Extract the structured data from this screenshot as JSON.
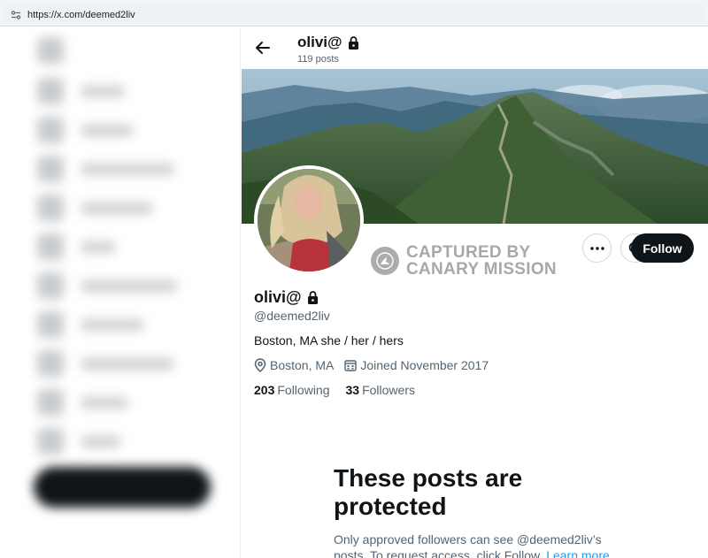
{
  "browser": {
    "url": "https://x.com/deemed2liv"
  },
  "header": {
    "name": "olivi@",
    "posts_count": "119 posts"
  },
  "profile": {
    "name": "olivi@",
    "handle": "@deemed2liv",
    "bio": "Boston, MA she / her / hers",
    "location": "Boston, MA",
    "joined": "Joined November 2017",
    "following_count": "203",
    "following_label": "Following",
    "followers_count": "33",
    "followers_label": "Followers"
  },
  "actions": {
    "follow_label": "Follow",
    "more_icon": "more-icon",
    "search_icon": "search-icon"
  },
  "watermark": {
    "line1": "CAPTURED BY",
    "line2": "CANARY MISSION"
  },
  "protected": {
    "heading": "These posts are protected",
    "body": "Only approved followers can see @deemed2liv’s posts. To request access, click Follow.",
    "learn_more": "Learn more"
  },
  "colors": {
    "accent": "#1d9bf0",
    "text": "#0f1419",
    "muted": "#536471",
    "follow_bg": "#0f1419"
  }
}
